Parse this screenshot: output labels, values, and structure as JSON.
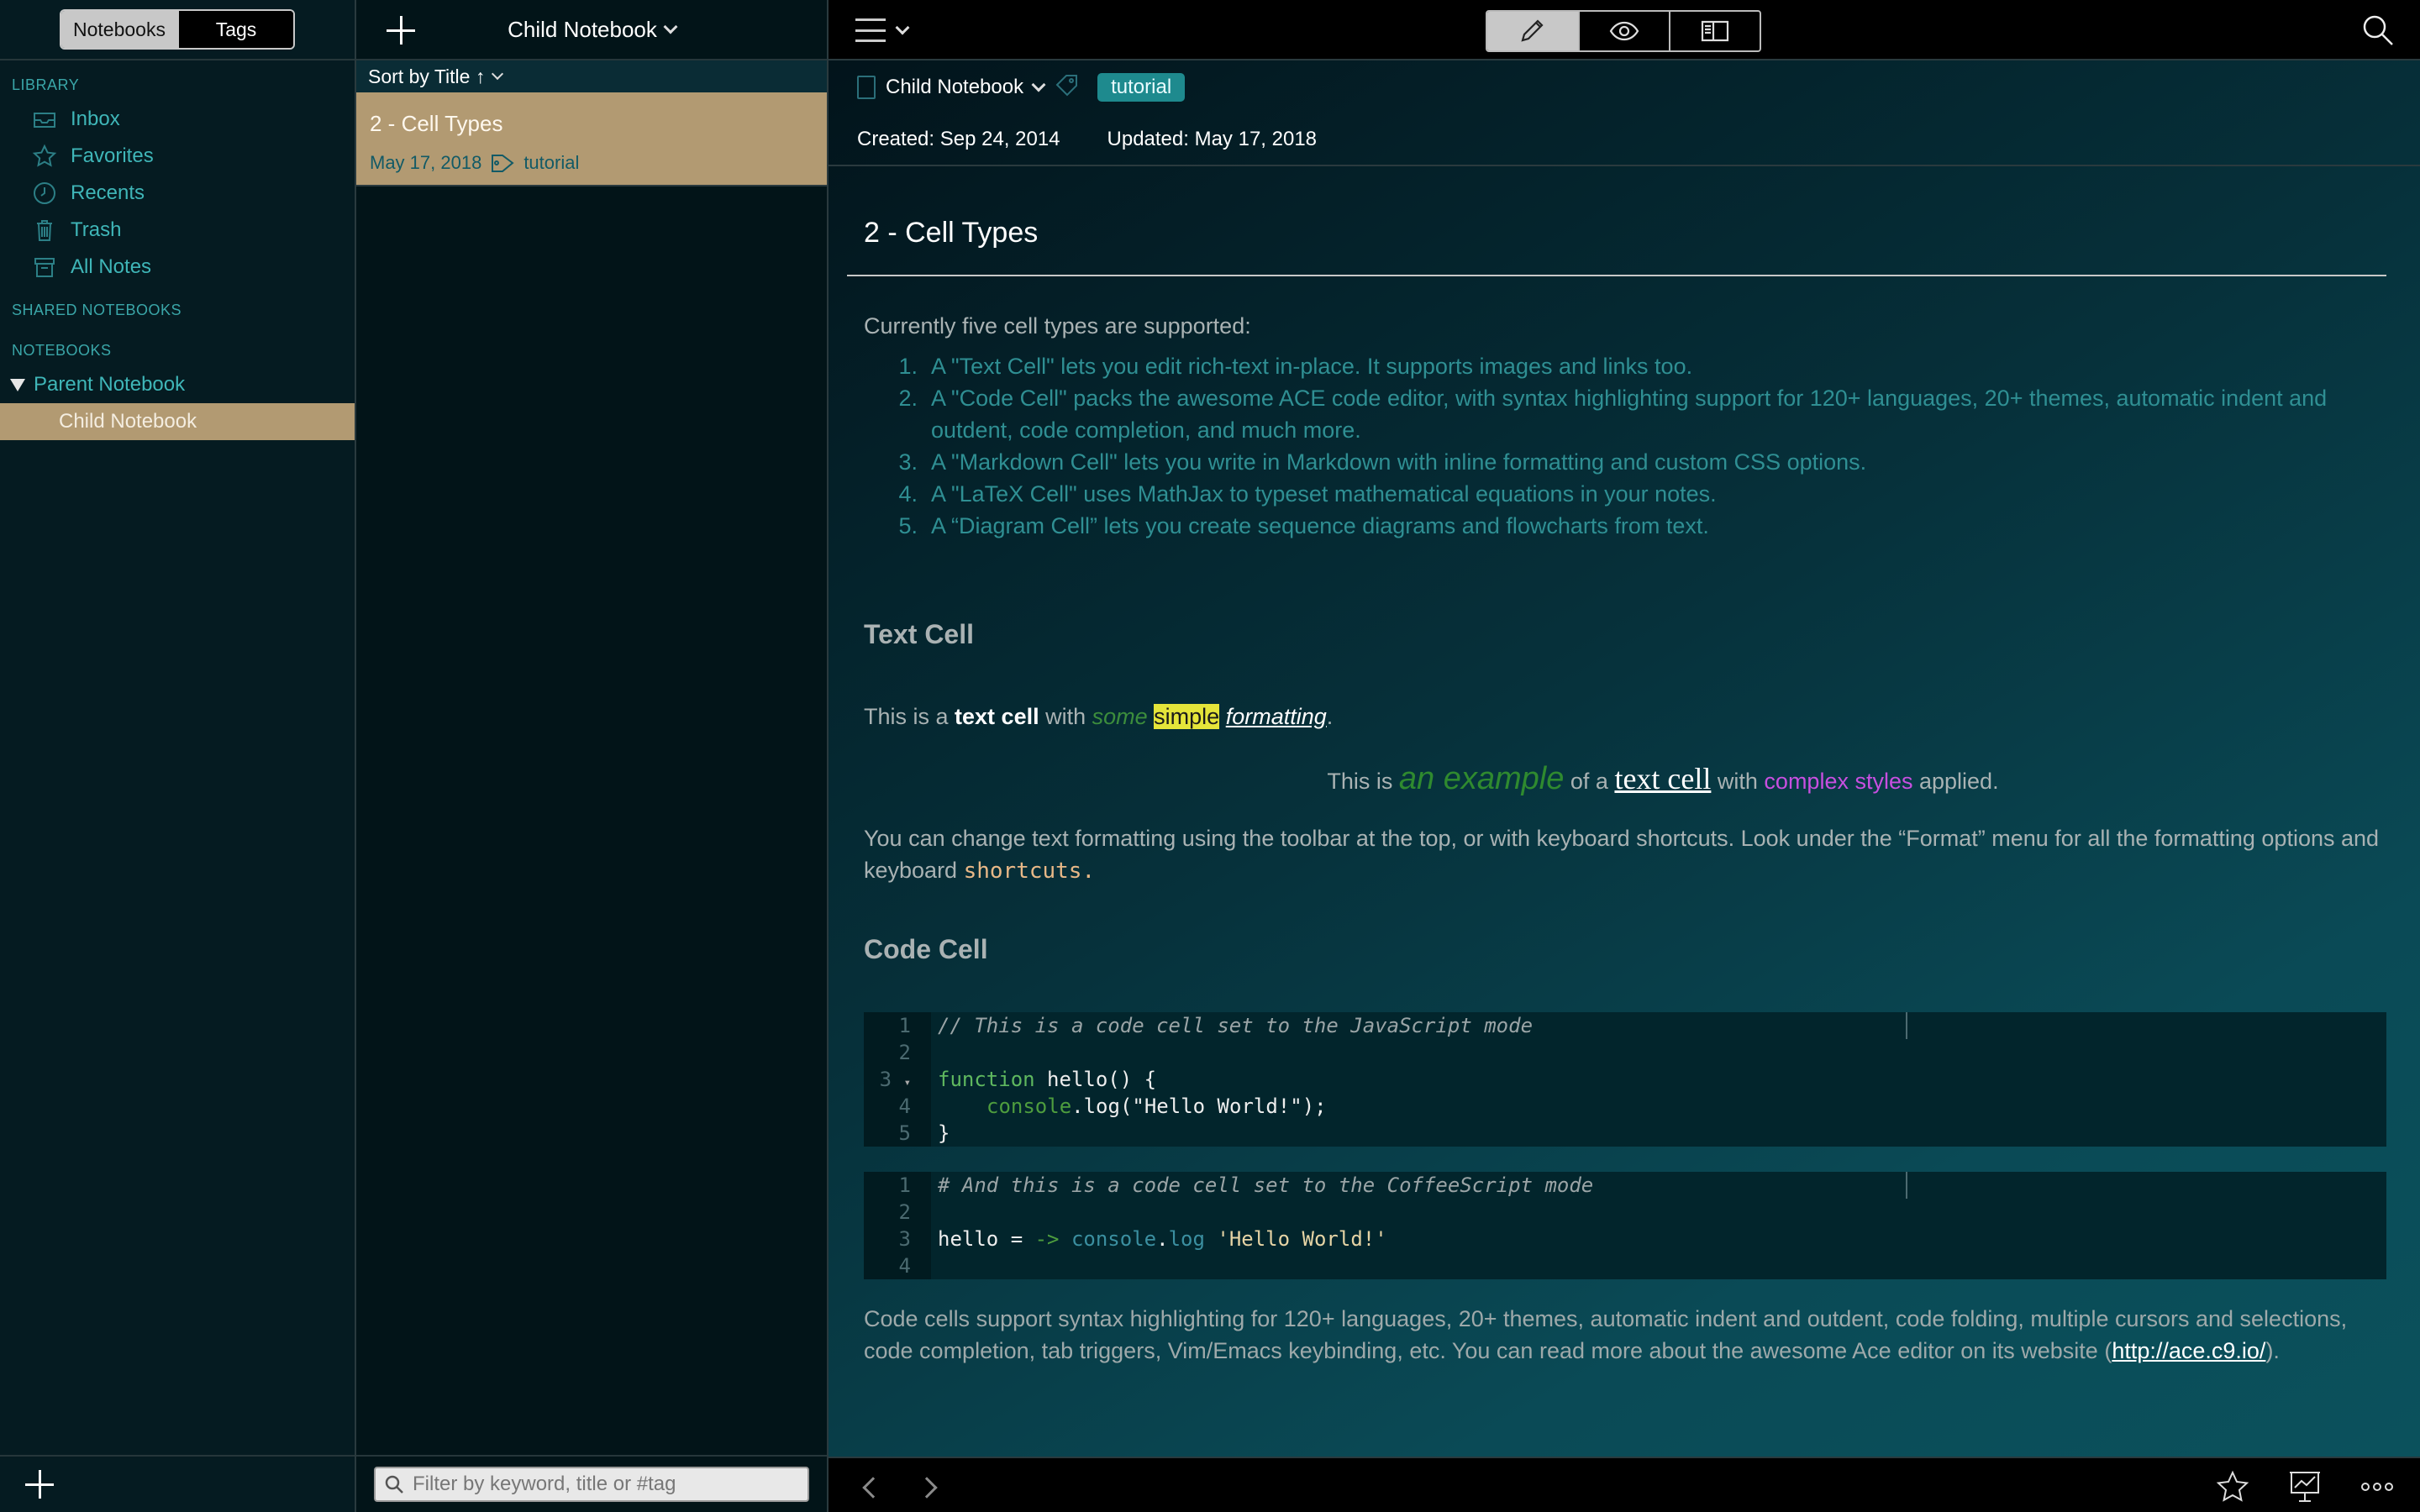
{
  "sidebar": {
    "seg_notebooks": "Notebooks",
    "seg_tags": "Tags",
    "library_header": "LIBRARY",
    "library_items": [
      {
        "label": "Inbox",
        "icon": "inbox-icon"
      },
      {
        "label": "Favorites",
        "icon": "star-icon"
      },
      {
        "label": "Recents",
        "icon": "clock-icon"
      },
      {
        "label": "Trash",
        "icon": "trash-icon"
      },
      {
        "label": "All Notes",
        "icon": "archive-icon"
      }
    ],
    "shared_header": "SHARED NOTEBOOKS",
    "notebooks_header": "NOTEBOOKS",
    "parent_notebook": "Parent Notebook",
    "child_notebook": "Child Notebook"
  },
  "note_list": {
    "title": "Child Notebook",
    "sort_label": "Sort by Title ↑",
    "notes": [
      {
        "title": "2 - Cell Types",
        "date": "May 17, 2018",
        "tag": "tutorial"
      }
    ],
    "filter_placeholder": "Filter by keyword, title or #tag"
  },
  "editor": {
    "notebook": "Child Notebook",
    "tag": "tutorial",
    "created": "Created: Sep 24, 2014",
    "updated": "Updated: May 17, 2018",
    "title": "2 - Cell Types",
    "intro": "Currently five cell types are supported:",
    "list": [
      {
        "n": "1.",
        "text": "A \"Text Cell\" lets you edit rich-text in-place. It supports images and links too."
      },
      {
        "n": "2.",
        "text": "A \"Code Cell\" packs the awesome ACE code editor, with syntax highlighting support for 120+ languages, 20+ themes, automatic indent and outdent, code completion, and much more."
      },
      {
        "n": "3.",
        "text": "A \"Markdown Cell\" lets you write in Markdown with inline formatting and custom CSS options."
      },
      {
        "n": "4.",
        "text": "A \"LaTeX Cell\" uses MathJax to typeset mathematical equations in your notes."
      },
      {
        "n": "5.",
        "text": "A “Diagram Cell” lets you create sequence diagrams and flowcharts from text."
      }
    ],
    "text_cell_heading": "Text Cell",
    "line1": {
      "a": "This is a ",
      "b": "text cell",
      "c": " with ",
      "d": "some",
      "e": " ",
      "f": "simple",
      "g": " ",
      "h": "formatting",
      "i": "."
    },
    "line2": {
      "a": "This is ",
      "b": "an example",
      "c": " of a ",
      "d": "text cell",
      "e": " with ",
      "f": "complex styles",
      "g": " applied."
    },
    "line3": {
      "a": "You can change text formatting using the toolbar at the top, or with keyboard shortcuts. Look under the “Format” menu for all the formatting options and keyboard ",
      "code": "shortcuts."
    },
    "code_cell_heading": "Code Cell",
    "code1": {
      "gutter": [
        "1",
        "2",
        "3",
        "4",
        "5"
      ],
      "l1": "// This is a code cell set to the JavaScript mode",
      "l3_kw": "function",
      "l3_rest": " hello() {",
      "l4_obj": "console",
      "l4_rest": ".log(\"Hello World!\");",
      "l5": "}"
    },
    "code2": {
      "gutter": [
        "1",
        "2",
        "3",
        "4"
      ],
      "l1": "# And this is a code cell set to the CoffeeScript mode",
      "l3_a": "hello = ",
      "l3_arrow": "->",
      "l3_obj": "console",
      "l3_dot": ".",
      "l3_fn": "log",
      "l3_str": "'Hello World!'"
    },
    "after": {
      "a": "Code cells support syntax highlighting for 120+ languages, 20+ themes, automatic indent and outdent, code folding, multiple cursors and selections, code completion, tab triggers, Vim/Emacs keybinding, etc. You can read more about the awesome Ace editor on its website (",
      "link": "http://ace.c9.io/",
      "b": ")."
    }
  },
  "colors": {
    "selection": "#b29a72",
    "accent": "#3fb6b8",
    "tag": "#1e8a8e"
  }
}
